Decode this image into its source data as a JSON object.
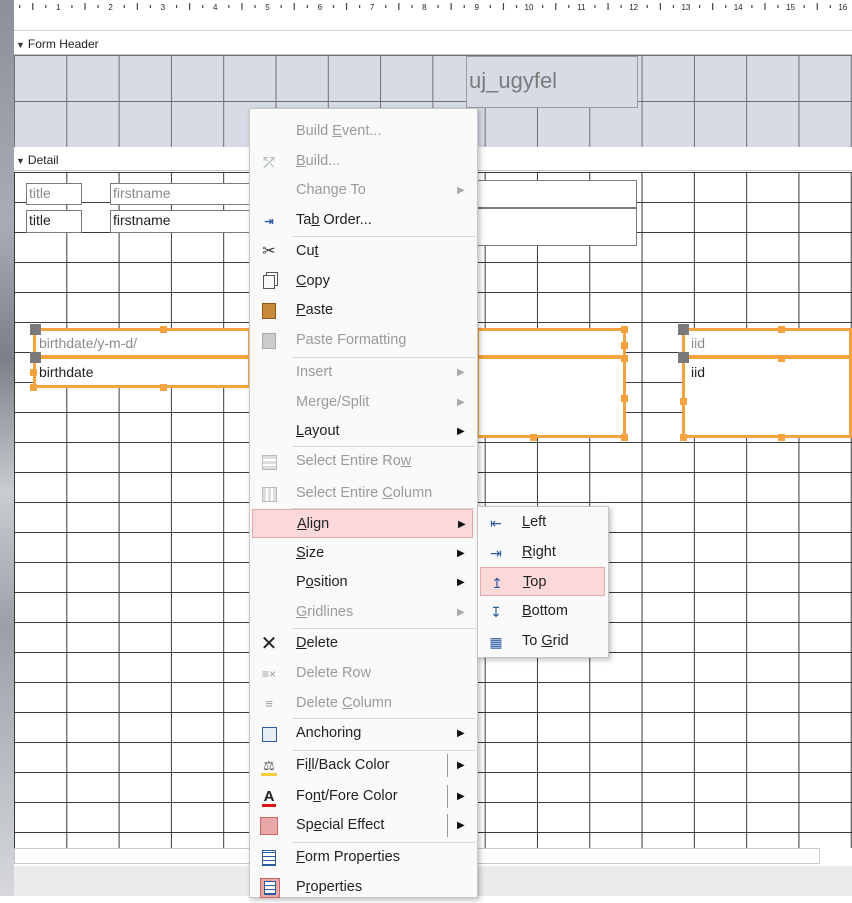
{
  "ruler": {
    "numbers": [
      "1",
      "2",
      "3",
      "4",
      "5",
      "6",
      "7",
      "8",
      "9",
      "10",
      "11",
      "12",
      "13",
      "14",
      "15",
      "16"
    ]
  },
  "form_header": {
    "label": "Form Header",
    "title": "uj_ugyfel"
  },
  "detail": {
    "label": "Detail",
    "controls": {
      "title_label": "title",
      "title_text": "title",
      "firstname_label": "firstname",
      "firstname_text": "firstname",
      "birthdate_label": "birthdate/y-m-d/",
      "birthdate_text": "birthdate",
      "iid_label": "iid",
      "iid_text": "iid"
    }
  },
  "context_menu": {
    "items": [
      {
        "pre": "Build ",
        "acc": "E",
        "post": "vent...",
        "disabled": true,
        "icon": ""
      },
      {
        "pre": "",
        "acc": "B",
        "post": "uild...",
        "disabled": true,
        "icon": "wand-icon"
      },
      {
        "pre": "Change To",
        "acc": "",
        "post": "",
        "disabled": true,
        "icon": "",
        "submenu": true
      },
      {
        "pre": "Ta",
        "acc": "b",
        "post": " Order...",
        "disabled": false,
        "icon": "tab-order-icon"
      },
      {
        "pre": "Cu",
        "acc": "t",
        "post": "",
        "disabled": false,
        "icon": "scissors-icon"
      },
      {
        "pre": "",
        "acc": "C",
        "post": "opy",
        "disabled": false,
        "icon": "copy-icon"
      },
      {
        "pre": "",
        "acc": "P",
        "post": "aste",
        "disabled": false,
        "icon": "paste-icon"
      },
      {
        "pre": "Paste Formatting",
        "acc": "",
        "post": "",
        "disabled": true,
        "icon": "paste-formatting-icon"
      },
      {
        "pre": "Insert",
        "acc": "",
        "post": "",
        "disabled": true,
        "icon": "",
        "submenu": true
      },
      {
        "pre": "Merge/Split",
        "acc": "",
        "post": "",
        "disabled": true,
        "icon": "",
        "submenu": true
      },
      {
        "pre": "",
        "acc": "L",
        "post": "ayout",
        "disabled": false,
        "icon": "",
        "submenu": true
      },
      {
        "pre": "Select Entire Ro",
        "acc": "w",
        "post": "",
        "disabled": true,
        "icon": "select-row-icon"
      },
      {
        "pre": "Select Entire ",
        "acc": "C",
        "post": "olumn",
        "disabled": true,
        "icon": "select-column-icon"
      },
      {
        "pre": "",
        "acc": "A",
        "post": "lign",
        "disabled": false,
        "icon": "",
        "submenu": true,
        "highlight": true
      },
      {
        "pre": "",
        "acc": "S",
        "post": "ize",
        "disabled": false,
        "icon": "",
        "submenu": true
      },
      {
        "pre": "P",
        "acc": "o",
        "post": "sition",
        "disabled": false,
        "icon": "",
        "submenu": true
      },
      {
        "pre": "",
        "acc": "G",
        "post": "ridlines",
        "disabled": true,
        "icon": "",
        "submenu": true
      },
      {
        "pre": "",
        "acc": "D",
        "post": "elete",
        "disabled": false,
        "icon": "delete-icon"
      },
      {
        "pre": "Delete Row",
        "acc": "",
        "post": "",
        "disabled": true,
        "icon": "delete-row-icon"
      },
      {
        "pre": "Delete ",
        "acc": "C",
        "post": "olumn",
        "disabled": true,
        "icon": "delete-column-icon"
      },
      {
        "pre": "Anchoring",
        "acc": "",
        "post": "",
        "disabled": false,
        "icon": "anchoring-icon",
        "submenu": true
      },
      {
        "pre": "Fi",
        "acc": "l",
        "post": "l/Back Color",
        "disabled": false,
        "icon": "fill-color-icon",
        "submenu": true,
        "split": true
      },
      {
        "pre": "Fo",
        "acc": "n",
        "post": "t/Fore Color",
        "disabled": false,
        "icon": "font-color-icon",
        "submenu": true,
        "split": true
      },
      {
        "pre": "Sp",
        "acc": "e",
        "post": "cial Effect",
        "disabled": false,
        "icon": "special-effect-icon",
        "submenu": true,
        "split": true
      },
      {
        "pre": "",
        "acc": "F",
        "post": "orm Properties",
        "disabled": false,
        "icon": "form-properties-icon"
      },
      {
        "pre": "P",
        "acc": "r",
        "post": "operties",
        "disabled": false,
        "icon": "properties-icon"
      }
    ]
  },
  "align_submenu": {
    "items": [
      {
        "pre": "",
        "acc": "L",
        "post": "eft",
        "icon": "align-left-icon"
      },
      {
        "pre": "",
        "acc": "R",
        "post": "ight",
        "icon": "align-right-icon"
      },
      {
        "pre": "",
        "acc": "T",
        "post": "op",
        "icon": "align-top-icon",
        "highlight": true
      },
      {
        "pre": "",
        "acc": "B",
        "post": "ottom",
        "icon": "align-bottom-icon"
      },
      {
        "pre": "To ",
        "acc": "G",
        "post": "rid",
        "icon": "align-to-grid-icon"
      }
    ]
  },
  "colors": {
    "selection": "#f4a340",
    "highlight": "#fbd9d9",
    "header_bg": "#d6dbe6"
  }
}
